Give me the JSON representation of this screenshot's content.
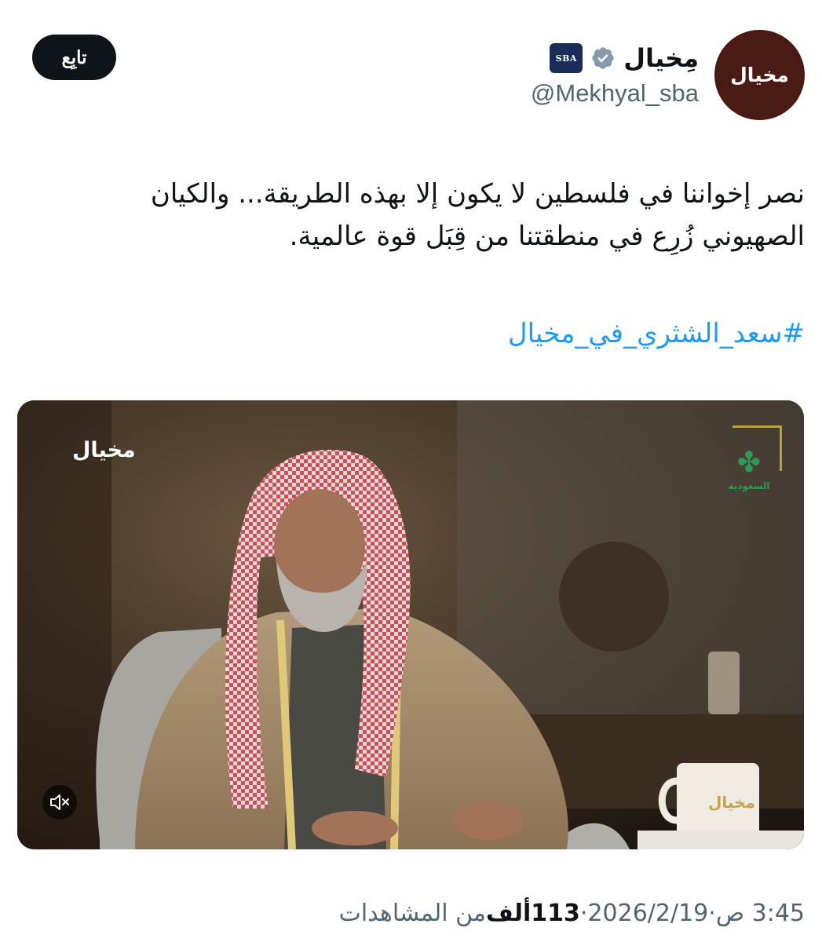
{
  "account": {
    "display_name": "مِخيال",
    "handle": "@Mekhyal_sba",
    "avatar_text": "مخيال",
    "affiliate_badge_text": "SBA",
    "verified_color": "#829aab"
  },
  "follow_button": {
    "label": "تابِع"
  },
  "tweet": {
    "text": "نصر إخواننا في فلسطين لا يكون إلا بهذه الطريقة... والكيان الصهيوني زُرِع في منطقتنا من قِبَل قوة عالمية.",
    "hashtag": "#سعد_الشثري_في_مخيال"
  },
  "media": {
    "type": "video",
    "watermark": "مخيال",
    "channel_logo_text": "السعودية",
    "mug_text": "مخيال",
    "mute_icon": "speaker-muted-icon"
  },
  "meta": {
    "time": "3:45 ص",
    "separator": " · ",
    "date": "2026/2/19",
    "views_count": "113ألف",
    "views_label": " من المشاهدات"
  },
  "colors": {
    "link": "#1d9bf0",
    "secondary_text": "#536471",
    "follow_bg": "#0f1419",
    "avatar_bg": "#4a1a14"
  }
}
